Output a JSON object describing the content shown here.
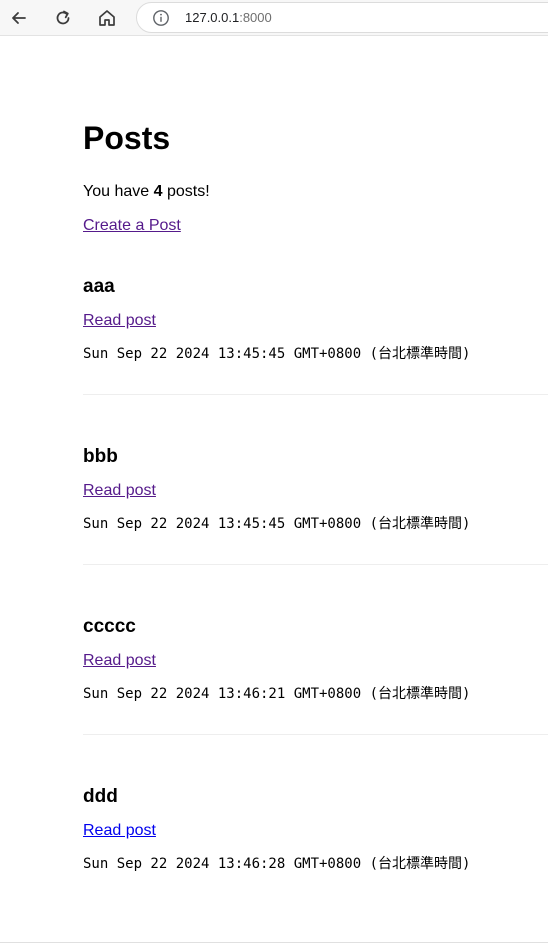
{
  "browser": {
    "url_host": "127.0.0.1",
    "url_port": ":8000",
    "icons": {
      "back": "arrow-left-icon",
      "reload": "reload-icon",
      "home": "home-icon",
      "site_info": "info-circle-icon"
    }
  },
  "page": {
    "title": "Posts",
    "count_prefix": "You have ",
    "count": "4",
    "count_suffix": " posts!",
    "create_link": "Create a Post"
  },
  "posts": [
    {
      "title": "aaa",
      "link": "Read post",
      "date": "Sun Sep 22 2024 13:45:45 GMT+0800 (台北標準時間)",
      "visited": true
    },
    {
      "title": "bbb",
      "link": "Read post",
      "date": "Sun Sep 22 2024 13:45:45 GMT+0800 (台北標準時間)",
      "visited": true
    },
    {
      "title": "ccccc",
      "link": "Read post",
      "date": "Sun Sep 22 2024 13:46:21 GMT+0800 (台北標準時間)",
      "visited": true
    },
    {
      "title": "ddd",
      "link": "Read post",
      "date": "Sun Sep 22 2024 13:46:28 GMT+0800 (台北標準時間)",
      "visited": false
    }
  ],
  "colors": {
    "visited_link": "#551a8b",
    "unvisited_link": "#0000ee"
  }
}
